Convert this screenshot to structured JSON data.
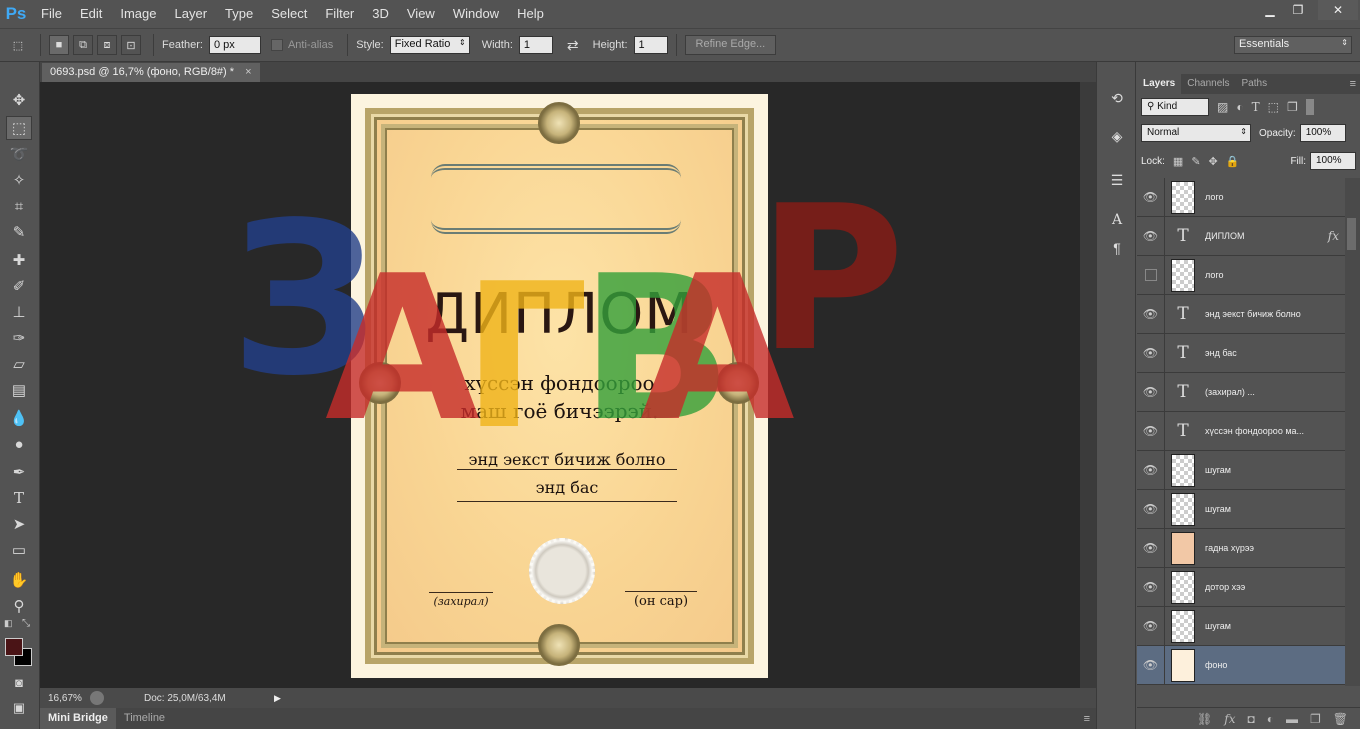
{
  "app": {
    "logo": "Ps",
    "menu": [
      "File",
      "Edit",
      "Image",
      "Layer",
      "Type",
      "Select",
      "Filter",
      "3D",
      "View",
      "Window",
      "Help"
    ],
    "window_controls": [
      "minimize-icon",
      "restore-icon",
      "close-icon"
    ]
  },
  "options": {
    "feather_label": "Feather:",
    "feather_value": "0 px",
    "antialias_label": "Anti-alias",
    "style_label": "Style:",
    "style_value": "Fixed Ratio",
    "width_label": "Width:",
    "width_value": "1",
    "height_label": "Height:",
    "height_value": "1",
    "refine_edge": "Refine Edge...",
    "workspace": "Essentials"
  },
  "document": {
    "tab_title": "0693.psd @ 16,7% (фоно, RGB/8#) *",
    "close_glyph": "×",
    "zoom": "16,67%",
    "doc_size": "Doc: 25,0M/63,4M"
  },
  "diploma": {
    "title": "ДИПЛОМ",
    "line1": "хүссэн фондоороо",
    "line2": "маш гоё бичээрэй.",
    "text1": "энд эекст бичиж болно",
    "text2": "энд бас",
    "sign": "(захирал)",
    "date": "(он сар)",
    "watermark": "ЗАГВАР",
    "watermark_colors": [
      "#233f8a",
      "#c62c2a",
      "#f0b419",
      "#34a03a",
      "#8a1c16"
    ]
  },
  "bottom_tabs": [
    "Mini Bridge",
    "Timeline"
  ],
  "panel": {
    "tabs": [
      "Layers",
      "Channels",
      "Paths"
    ],
    "kind_label": "Kind",
    "blend_mode": "Normal",
    "opacity_label": "Opacity:",
    "opacity_value": "100%",
    "lock_label": "Lock:",
    "fill_label": "Fill:",
    "fill_value": "100%",
    "fx_label": "fx",
    "layers": [
      {
        "name": "лого",
        "type": "image",
        "visible": true
      },
      {
        "name": "ДИПЛОМ",
        "type": "text",
        "visible": true,
        "fx": true
      },
      {
        "name": "лого",
        "type": "image",
        "visible": false
      },
      {
        "name": "энд эекст бичиж болно",
        "type": "text",
        "visible": true
      },
      {
        "name": "энд бас",
        "type": "text",
        "visible": true
      },
      {
        "name": "(захирал)          ...",
        "type": "text",
        "visible": true
      },
      {
        "name": "хүссэн фондоороо ма...",
        "type": "text",
        "visible": true
      },
      {
        "name": "шугам",
        "type": "image",
        "visible": true
      },
      {
        "name": "шугам",
        "type": "image",
        "visible": true
      },
      {
        "name": "гадна хүрээ",
        "type": "peach",
        "visible": true
      },
      {
        "name": "дотор хээ",
        "type": "image",
        "visible": true
      },
      {
        "name": "шугам",
        "type": "image",
        "visible": true
      },
      {
        "name": "фоно",
        "type": "cream",
        "visible": true,
        "selected": true
      }
    ]
  },
  "colors": {
    "foreground": "#4a1416",
    "background": "#000000",
    "selection": "#5c6c82"
  }
}
